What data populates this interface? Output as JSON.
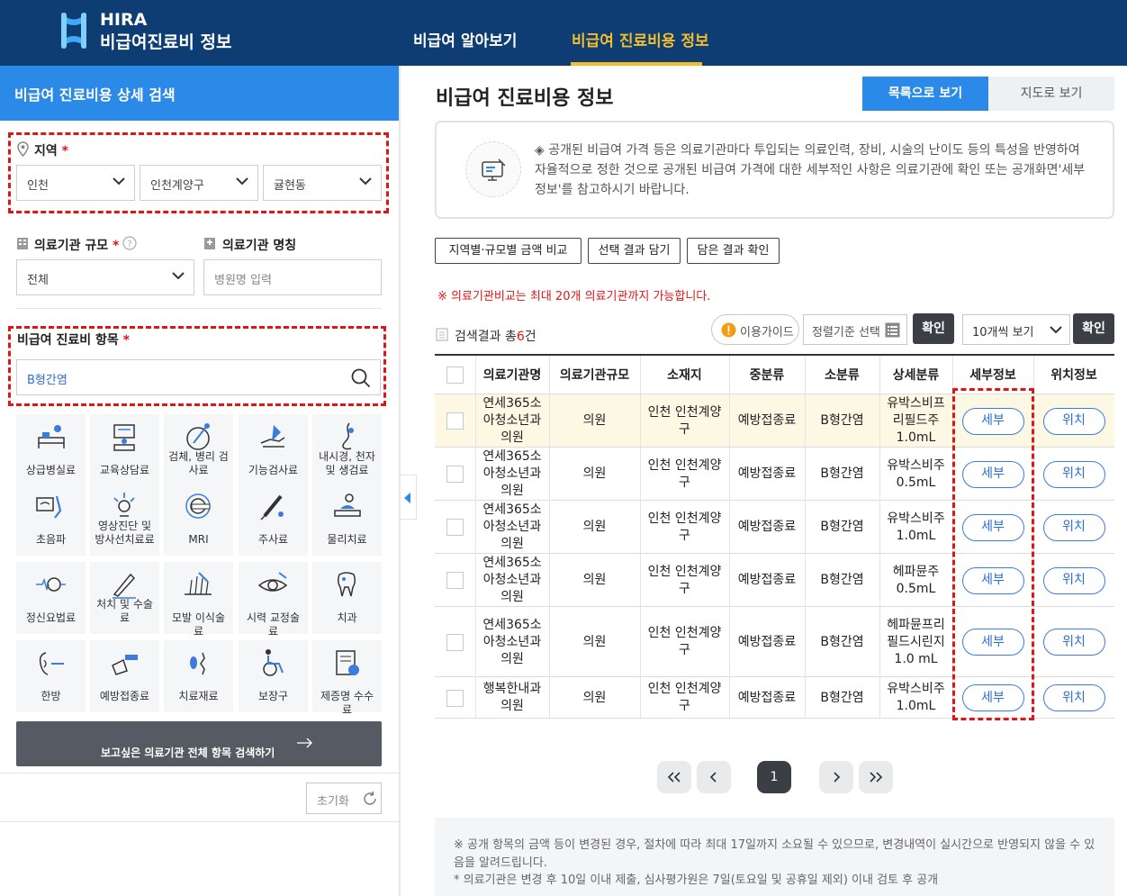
{
  "header": {
    "logo_en": "HIRA",
    "logo_ko": "비급여진료비 정보",
    "nav": [
      {
        "label": "비급여 알아보기",
        "active": false
      },
      {
        "label": "비급여 진료비용 정보",
        "active": true
      }
    ],
    "accent_color": "#f3bd2b",
    "bg_color": "#0d3d73"
  },
  "sidebar": {
    "title": "비급여 진료비용 상세 검색",
    "region": {
      "label": "지역",
      "required": "*",
      "sido": "인천",
      "sigungu": "인천계양구",
      "dong": "귤현동"
    },
    "scale": {
      "label": "의료기관 규모",
      "required": "*",
      "value": "전체"
    },
    "name": {
      "label": "의료기관 명칭",
      "placeholder": "병원명 입력"
    },
    "item": {
      "label": "비급여 진료비 항목",
      "required": "*",
      "value": "B형간염"
    },
    "categories": [
      {
        "label": "상급병실료",
        "icon": "hospital-bed-icon"
      },
      {
        "label": "교육상담료",
        "icon": "consultation-icon"
      },
      {
        "label": "검체, 병리 검사료",
        "icon": "specimen-test-icon"
      },
      {
        "label": "기능검사료",
        "icon": "function-test-icon"
      },
      {
        "label": "내시경, 천자 및 생검료",
        "icon": "endoscope-icon"
      },
      {
        "label": "초음파",
        "icon": "ultrasound-icon"
      },
      {
        "label": "영상진단 및 방사선치료료",
        "icon": "radiology-icon"
      },
      {
        "label": "MRI",
        "icon": "mri-icon"
      },
      {
        "label": "주사료",
        "icon": "syringe-icon"
      },
      {
        "label": "물리치료",
        "icon": "physical-therapy-icon"
      },
      {
        "label": "정신요법료",
        "icon": "psychotherapy-icon"
      },
      {
        "label": "처치 및 수술료",
        "icon": "surgery-icon"
      },
      {
        "label": "모발 이식술료",
        "icon": "hair-transplant-icon"
      },
      {
        "label": "시력 교정술료",
        "icon": "eye-icon"
      },
      {
        "label": "치과",
        "icon": "tooth-icon"
      },
      {
        "label": "한방",
        "icon": "acupuncture-icon"
      },
      {
        "label": "예방접종료",
        "icon": "vaccine-icon"
      },
      {
        "label": "치료재료",
        "icon": "treatment-material-icon"
      },
      {
        "label": "보장구",
        "icon": "wheelchair-icon"
      },
      {
        "label": "제증명 수수료",
        "icon": "certificate-icon"
      }
    ],
    "search_all_label": "보고싶은 의료기관 전체 항목 검색하기",
    "reset_label": "초기화"
  },
  "main": {
    "title": "비급여 진료비용 정보",
    "list_view_label": "목록으로 보기",
    "map_view_label": "지도로 보기",
    "notice": "◈ 공개된 비급여 가격 등은 의료기관마다 투입되는 의료인력, 장비, 시술의 난이도 등의 특성을 반영하여 자율적으로 정한 것으로 공개된 비급여 가격에 대한 세부적인 사항은 의료기관에 확인 또는 공개화면'세부정보'를 참고하시기 바랍니다.",
    "actions": [
      "지역별·규모별 금액 비교",
      "선택 결과 담기",
      "담은 결과 확인"
    ],
    "warning": "※ 의료기관비교는 최대 20개 의료기관까지 가능합니다.",
    "result_prefix": "검색결과 총",
    "result_count": "6",
    "result_suffix": "건",
    "guide_label": "이용가이드",
    "sort_label": "정렬기준 선택",
    "confirm_label": "확인",
    "page_size": "10개씩 보기",
    "columns": [
      "의료기관명",
      "의료기관규모",
      "소재지",
      "중분류",
      "소분류",
      "상세분류",
      "세부정보",
      "위치정보"
    ],
    "detail_label": "세부",
    "location_label": "위치",
    "rows": [
      {
        "name": "연세365소아청소년과의원",
        "scale": "의원",
        "addr": "인천 인천계양구",
        "mid": "예방접종료",
        "sub": "B형간염",
        "detail": "유박스비프리필드주 1.0mL"
      },
      {
        "name": "연세365소아청소년과의원",
        "scale": "의원",
        "addr": "인천 인천계양구",
        "mid": "예방접종료",
        "sub": "B형간염",
        "detail": "유박스비주 0.5mL"
      },
      {
        "name": "연세365소아청소년과의원",
        "scale": "의원",
        "addr": "인천 인천계양구",
        "mid": "예방접종료",
        "sub": "B형간염",
        "detail": "유박스비주 1.0mL"
      },
      {
        "name": "연세365소아청소년과의원",
        "scale": "의원",
        "addr": "인천 인천계양구",
        "mid": "예방접종료",
        "sub": "B형간염",
        "detail": "헤파뮨주 0.5mL"
      },
      {
        "name": "연세365소아청소년과의원",
        "scale": "의원",
        "addr": "인천 인천계양구",
        "mid": "예방접종료",
        "sub": "B형간염",
        "detail": "헤파뮨프리필드시린지 1.0 mL"
      },
      {
        "name": "행복한내과의원",
        "scale": "의원",
        "addr": "인천 인천계양구",
        "mid": "예방접종료",
        "sub": "B형간염",
        "detail": "유박스비주 1.0mL"
      }
    ],
    "current_page": "1",
    "footer": [
      "※ 공개 항목의 금액 등이 변경된 경우, 절차에 따라 최대 17일까지 소요될 수 있으므로, 변경내역이 실시간으로 반영되지 않을 수 있음을 알려드립니다.",
      "* 의료기관은 변경 후 10일 이내 제출, 심사평가원은 7일(토요일 및 공휴일 제외) 이내 검토 후 공개"
    ]
  }
}
